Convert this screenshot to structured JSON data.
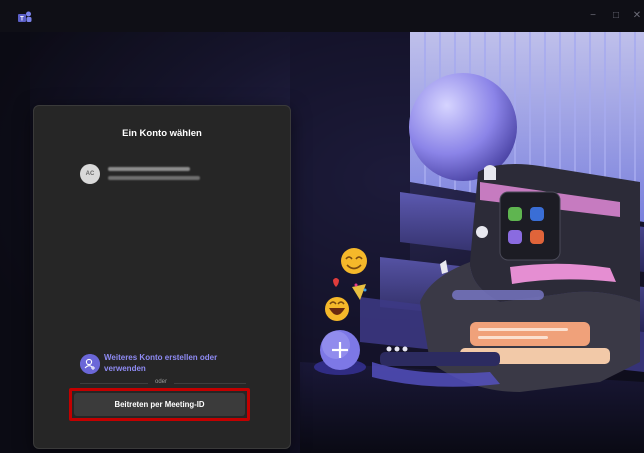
{
  "window": {
    "app_icon": "teams-logo-icon",
    "controls": [
      "minimize",
      "maximize",
      "close"
    ],
    "min_symbol": "−",
    "max_symbol": "□",
    "close_symbol": "✕"
  },
  "signin": {
    "title": "Ein Konto wählen",
    "account": {
      "avatar_initials": "AC"
    },
    "other_account_label": "Weiteres Konto erstellen oder verwenden",
    "divider_label": "oder",
    "join_button": "Beitreten per Meeting-ID"
  },
  "colors": {
    "accent": "#8f8bf4",
    "highlight": "#c20000",
    "card": "#262626"
  }
}
